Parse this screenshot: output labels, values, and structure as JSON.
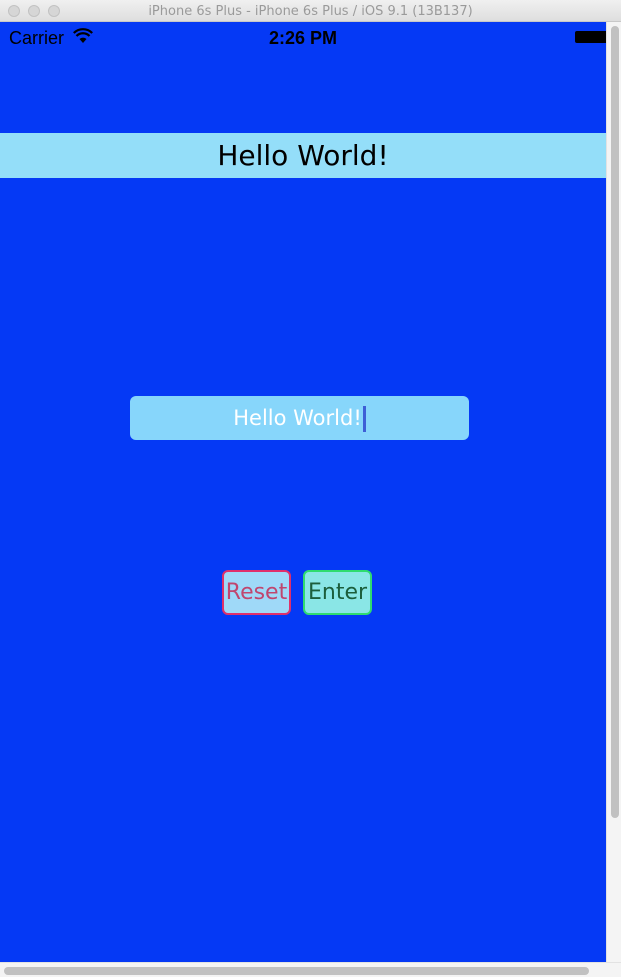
{
  "window": {
    "title": "iPhone 6s Plus - iPhone 6s Plus / iOS 9.1 (13B137)"
  },
  "status_bar": {
    "carrier": "Carrier",
    "time": "2:26 PM"
  },
  "banner": {
    "text": "Hello World!"
  },
  "text_field": {
    "value": "Hello World!"
  },
  "buttons": {
    "reset_label": "Reset",
    "enter_label": "Enter"
  },
  "colors": {
    "background": "#0539f5",
    "banner": "#94def9",
    "text_field": "#87d6fb",
    "reset_border": "#e0306b",
    "enter_border": "#2fdc6f"
  }
}
